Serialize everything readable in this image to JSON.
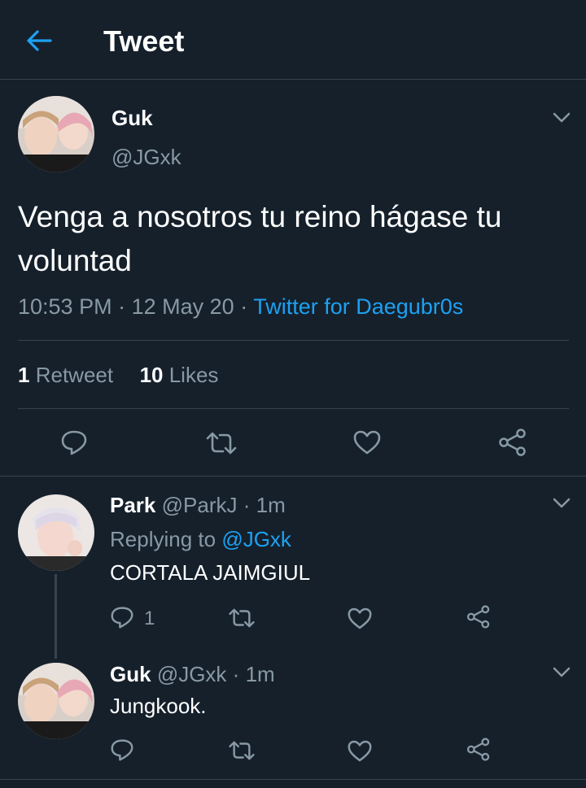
{
  "header": {
    "title": "Tweet",
    "back_icon": "arrow-left-icon",
    "accent": "#1da1f2"
  },
  "main_tweet": {
    "author_name": "Guk",
    "author_handle": "@JGxk",
    "text": "Venga a nosotros tu reino hágase tu voluntad",
    "time": "10:53 PM",
    "date": "12 May 20",
    "source": "Twitter for Daegubr0s",
    "retweet_count": "1",
    "retweet_label": "Retweet",
    "like_count": "10",
    "like_label": "Likes"
  },
  "replies": [
    {
      "name": "Park",
      "handle": "@ParkJ",
      "time": "1m",
      "replying_label": "Replying to",
      "replying_to": "@JGxk",
      "text": "CORTALA JAIMGIUL",
      "reply_count": "1"
    },
    {
      "name": "Guk",
      "handle": "@JGxk",
      "time": "1m",
      "text": "Jungkook."
    }
  ],
  "colors": {
    "background": "#15202b",
    "secondary_text": "#8899a6",
    "divider": "#38444d",
    "link": "#1da1f2"
  }
}
